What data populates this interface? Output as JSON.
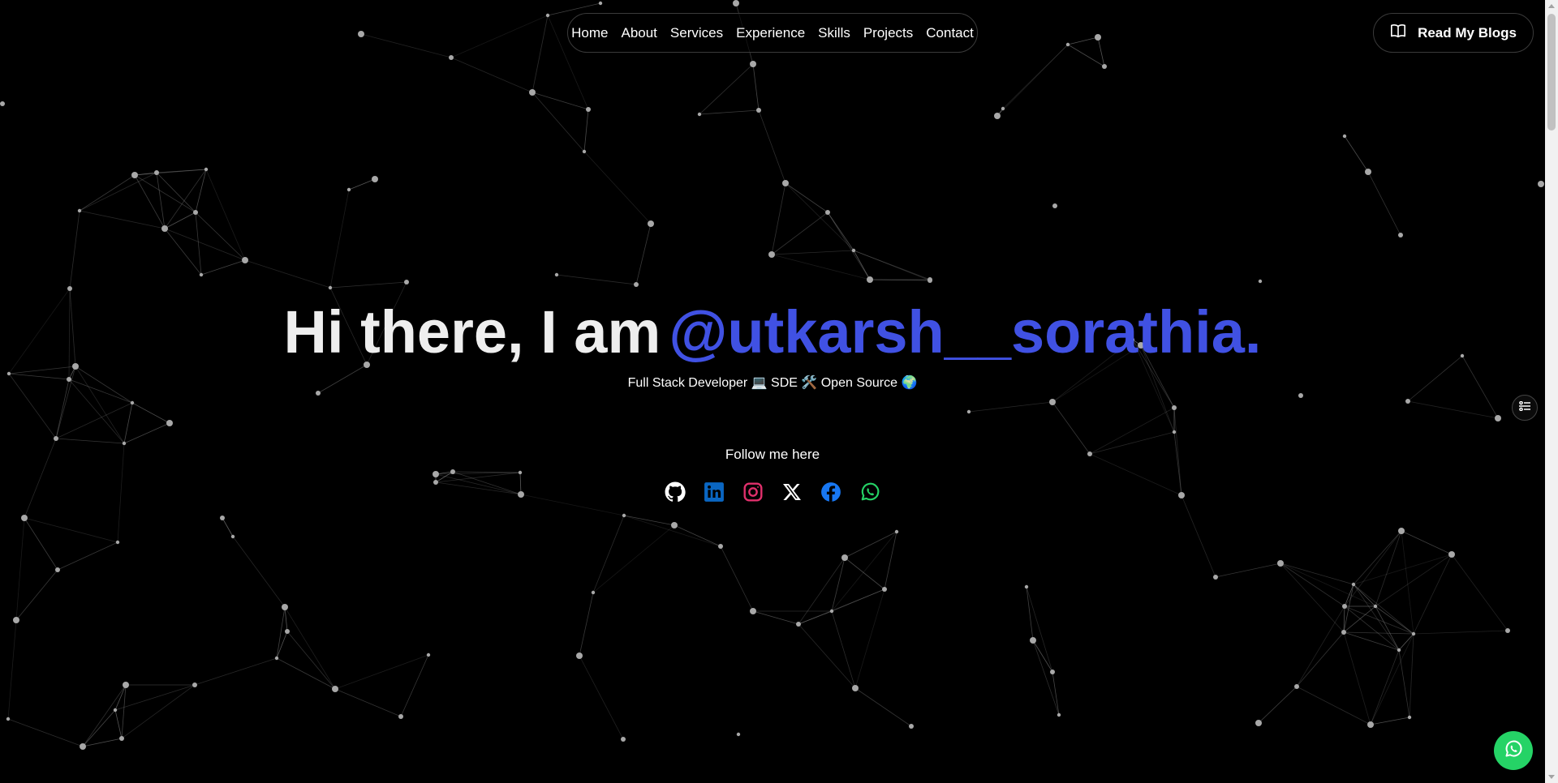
{
  "nav": {
    "items": [
      "Home",
      "About",
      "Services",
      "Experience",
      "Skills",
      "Projects",
      "Contact"
    ]
  },
  "blog_button": {
    "label": "Read My Blogs",
    "icon": "book-open-icon"
  },
  "hero": {
    "lead": "Hi there, I am",
    "handle": "@utkarsh__sorathia.",
    "subtitle": "Full Stack Developer 💻 SDE 🛠️ Open Source 🌍",
    "follow_label": "Follow me here"
  },
  "socials": [
    {
      "name": "github-icon",
      "color": "#ffffff"
    },
    {
      "name": "linkedin-icon",
      "color": "#0a66c2"
    },
    {
      "name": "instagram-icon",
      "color": "#e1306c"
    },
    {
      "name": "x-icon",
      "color": "#ffffff"
    },
    {
      "name": "facebook-icon",
      "color": "#1877f2"
    },
    {
      "name": "whatsapp-icon",
      "color": "#25d366"
    }
  ],
  "colors": {
    "background": "#000000",
    "accent": "#4051e3",
    "whatsapp": "#25d366"
  }
}
